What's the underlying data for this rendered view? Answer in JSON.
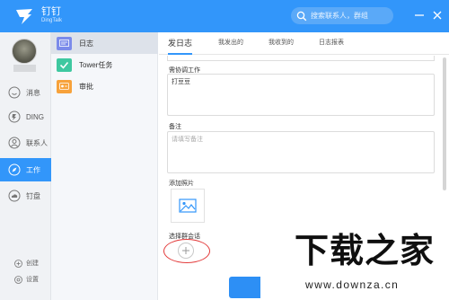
{
  "titlebar": {
    "app_name": "钉钉",
    "app_sub": "DingTalk",
    "search_placeholder": "搜索联系人，群组"
  },
  "leftnav": {
    "items": [
      {
        "label": "消息",
        "icon": "message-icon"
      },
      {
        "label": "DING",
        "icon": "ding-icon"
      },
      {
        "label": "联系人",
        "icon": "contacts-icon"
      },
      {
        "label": "工作",
        "icon": "work-icon",
        "active": true
      },
      {
        "label": "钉盘",
        "icon": "cloud-disk-icon"
      }
    ],
    "bottom": [
      {
        "label": "创建",
        "icon": "create-icon"
      },
      {
        "label": "设置",
        "icon": "settings-icon"
      }
    ]
  },
  "submenu": {
    "items": [
      {
        "label": "日志",
        "icon": "log-icon",
        "color": "#7b8bea",
        "active": true
      },
      {
        "label": "Tower任务",
        "icon": "check-icon",
        "color": "#3fc8a0"
      },
      {
        "label": "审批",
        "icon": "approval-icon",
        "color": "#f7a23b"
      }
    ]
  },
  "main": {
    "tabs": [
      "发日志",
      "我发出的",
      "我收到的",
      "日志报表"
    ],
    "coordination_label": "需协调工作",
    "coordination_value": "打豆豆",
    "remark_label": "备注",
    "remark_placeholder": "请填写备注",
    "photo_label": "添加照片",
    "group_label": "选择群会话"
  },
  "watermark": {
    "title": "下载之家",
    "url": "www.downza.cn"
  },
  "colors": {
    "accent": "#3296fa",
    "highlight_circle": "#e33b3b"
  }
}
